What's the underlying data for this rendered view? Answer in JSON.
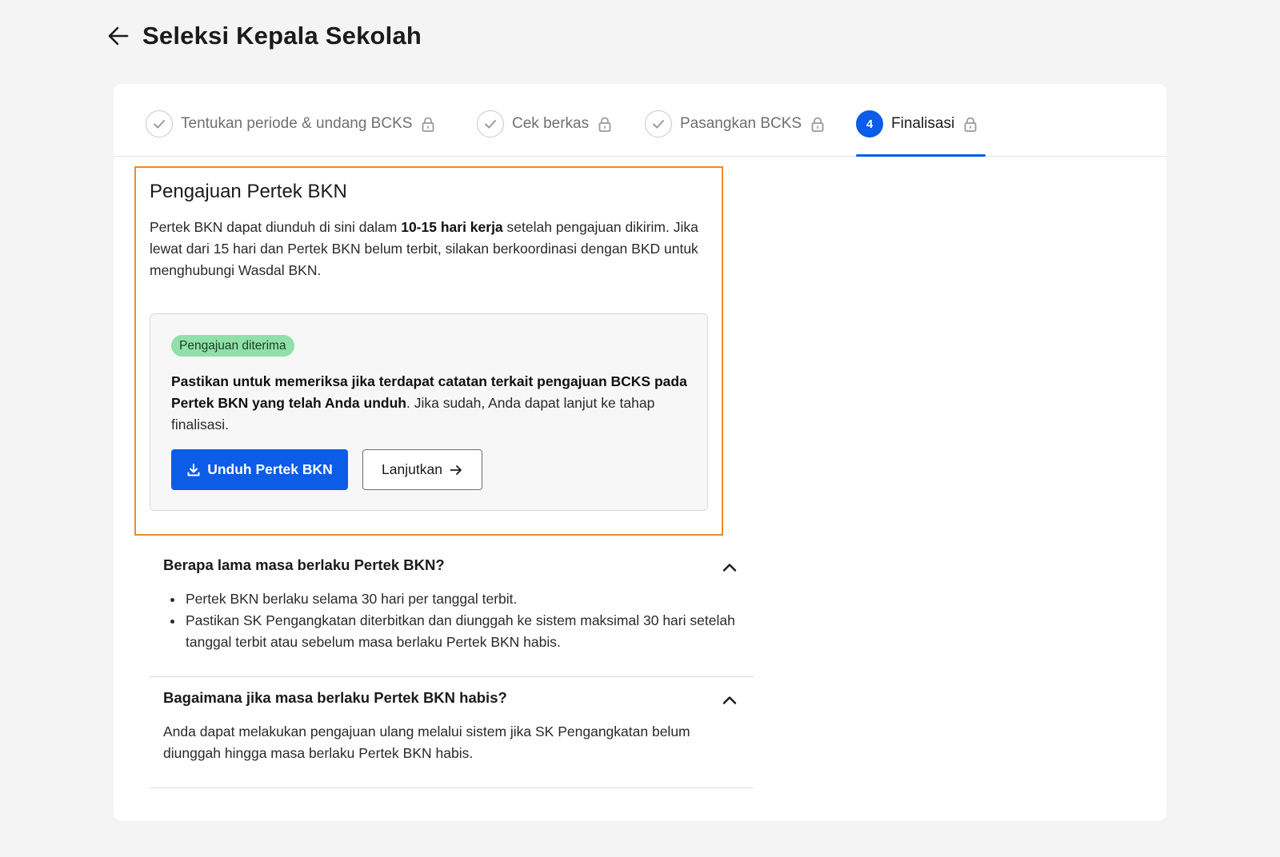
{
  "header": {
    "title": "Seleksi Kepala Sekolah"
  },
  "stepper": {
    "steps": [
      {
        "label": "Tentukan periode & undang BCKS",
        "status": "done"
      },
      {
        "label": "Cek berkas",
        "status": "done"
      },
      {
        "label": "Pasangkan BCKS",
        "status": "done"
      },
      {
        "label": "Finalisasi",
        "status": "active",
        "number": "4"
      }
    ]
  },
  "section": {
    "title": "Pengajuan Pertek BKN",
    "desc_pre": "Pertek BKN dapat diunduh di sini dalam ",
    "desc_bold": "10-15 hari kerja",
    "desc_post": " setelah pengajuan dikirim. Jika lewat dari 15 hari dan Pertek BKN belum terbit, silakan berkoordinasi dengan BKD untuk menghubungi Wasdal BKN."
  },
  "status_card": {
    "badge": "Pengajuan diterima",
    "text_bold": "Pastikan untuk memeriksa jika terdapat catatan terkait pengajuan BCKS pada Pertek BKN yang telah Anda unduh",
    "text_post": ". Jika sudah, Anda dapat lanjut ke tahap finalisasi.",
    "download_label": "Unduh Pertek BKN",
    "continue_label": "Lanjutkan"
  },
  "faqs": [
    {
      "question": "Berapa lama masa berlaku Pertek BKN?",
      "bullets": [
        "Pertek BKN berlaku selama 30 hari per tanggal terbit.",
        "Pastikan SK Pengangkatan diterbitkan dan diunggah ke sistem maksimal 30 hari setelah tanggal terbit atau sebelum masa berlaku Pertek BKN habis."
      ]
    },
    {
      "question": "Bagaimana jika masa berlaku Pertek BKN habis?",
      "answer": "Anda dapat melakukan pengajuan ulang melalui sistem jika SK Pengangkatan belum diunggah hingga masa berlaku Pertek BKN habis."
    }
  ],
  "colors": {
    "primary": "#0b5ce6",
    "badge_bg": "#8fe0a9",
    "highlight": "#f08a24"
  },
  "icons": {
    "back": "arrow-left-icon",
    "done": "check-icon",
    "lock": "lock-icon",
    "download": "download-icon",
    "continue": "arrow-right-icon",
    "collapse": "chevron-up-icon"
  }
}
